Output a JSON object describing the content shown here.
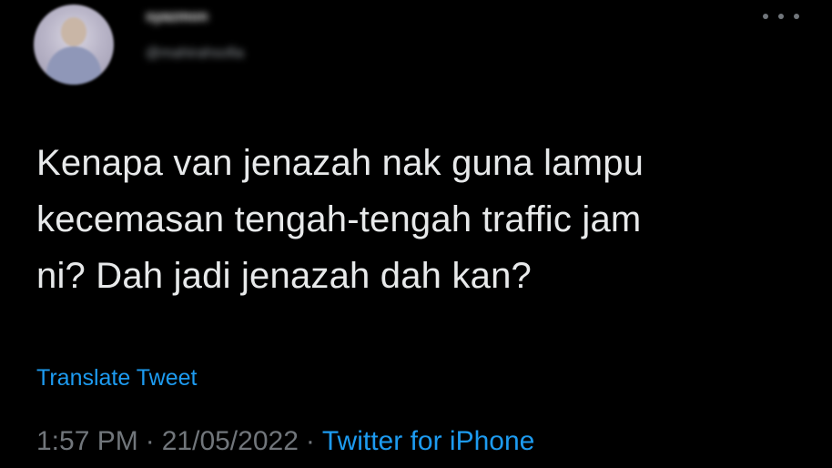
{
  "author": {
    "display_name": "syazmon",
    "handle": "@mahirahsofia",
    "avatar_icon": "user-avatar"
  },
  "menu_icon": "more-horizontal-icon",
  "tweet": {
    "lines": [
      "Kenapa van jenazah nak guna lampu",
      "kecemasan tengah-tengah traffic jam",
      "ni? Dah jadi jenazah dah kan?"
    ],
    "translate_label": "Translate Tweet",
    "time": "1:57 PM",
    "separator": "·",
    "date": "21/05/2022",
    "source": "Twitter for iPhone"
  },
  "colors": {
    "background": "#000000",
    "text": "#e7e9ea",
    "secondary": "#71767b",
    "link": "#1d9bf0"
  }
}
